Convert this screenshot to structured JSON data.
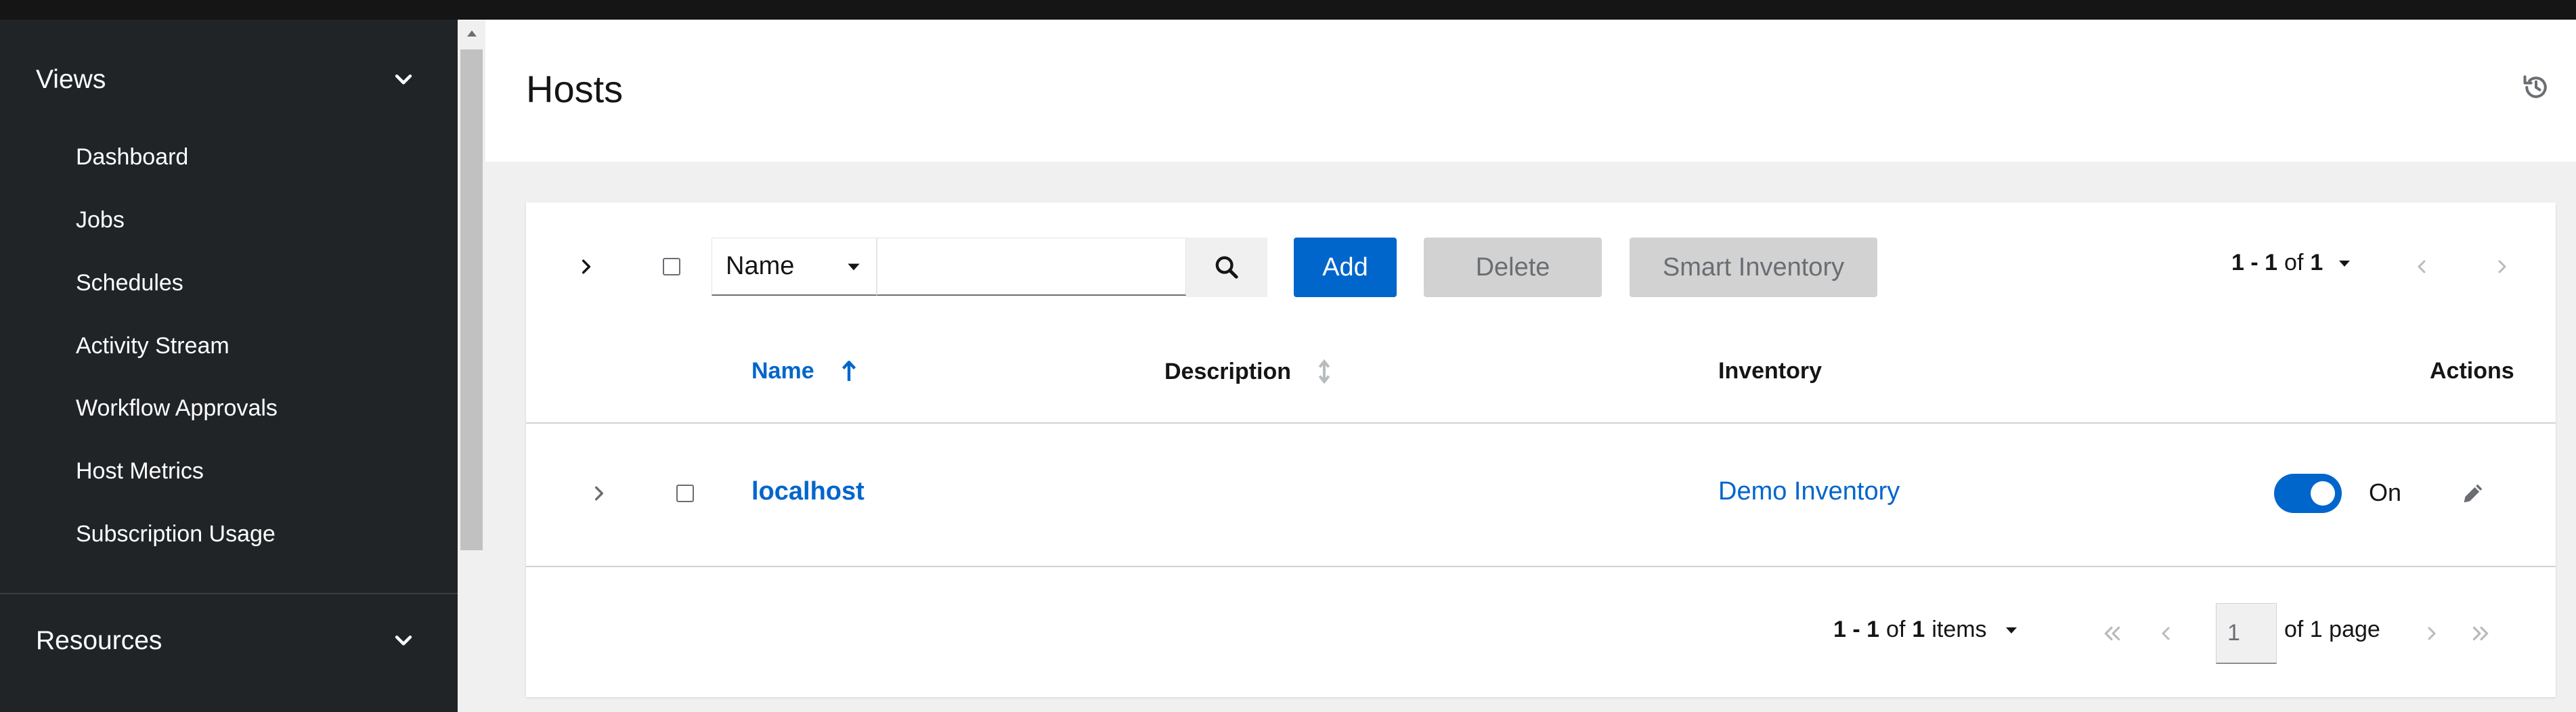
{
  "colors": {
    "topbar": "#151515",
    "sidebar_bg": "#212427",
    "accent": "#0066cc",
    "disabled_bg": "#d2d2d2",
    "page_bg": "#f0f0f0"
  },
  "sidebar": {
    "views_group": {
      "label": "Views",
      "icon": "chevron-down-icon",
      "items": [
        {
          "label": "Dashboard"
        },
        {
          "label": "Jobs"
        },
        {
          "label": "Schedules"
        },
        {
          "label": "Activity Stream"
        },
        {
          "label": "Workflow Approvals"
        },
        {
          "label": "Host Metrics"
        },
        {
          "label": "Subscription Usage"
        }
      ]
    },
    "resources_group": {
      "label": "Resources",
      "icon": "chevron-down-icon"
    }
  },
  "header": {
    "title": "Hosts",
    "history_icon": "history-icon"
  },
  "toolbar": {
    "filter_key": "Name",
    "search_value": "",
    "add_label": "Add",
    "delete_label": "Delete",
    "smart_inventory_label": "Smart Inventory",
    "pagination": {
      "range": "1 - 1",
      "of_text": "of",
      "total": "1"
    }
  },
  "table": {
    "columns": {
      "name": "Name",
      "description": "Description",
      "inventory": "Inventory",
      "actions": "Actions"
    },
    "rows": [
      {
        "name": "localhost",
        "description": "",
        "inventory": "Demo Inventory",
        "enabled": true,
        "enabled_label": "On"
      }
    ]
  },
  "footer_pagination": {
    "range": "1 - 1",
    "of_text": "of",
    "total": "1",
    "items_word": "items",
    "current_page": "1",
    "of_pages": "of 1 page"
  }
}
